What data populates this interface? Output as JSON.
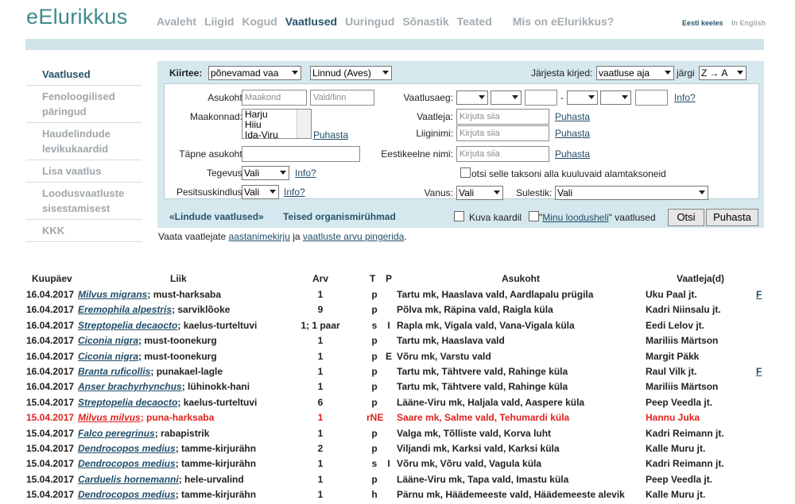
{
  "logo": "eElurikkus",
  "topnav": [
    "Avaleht",
    "Liigid",
    "Kogud",
    "Vaatlused",
    "Uuringud",
    "Sõnastik",
    "Teated"
  ],
  "topnav_active": "Vaatlused",
  "topnav_about": "Mis on eElurikkus?",
  "lang": {
    "et": "Eesti keeles",
    "en": "In English"
  },
  "sidebar": [
    {
      "label": "Vaatlused",
      "active": true
    },
    {
      "label": "Fenoloogilised päringud"
    },
    {
      "label": "Haudelindude levikukaardid"
    },
    {
      "label": "Lisa vaatlus"
    },
    {
      "label": "Loodusvaatluste sisestamisest"
    },
    {
      "label": "KKK"
    }
  ],
  "filter": {
    "kiirtee_label": "Kiirtee:",
    "kiirtee_value": "põnevamad vaa",
    "group_value": "Linnud (Aves)",
    "sort_label": "Järjesta kirjed:",
    "sort_value": "vaatluse aja",
    "sort_by_label": "järgi",
    "order_value": "Z → A",
    "asukoht_label": "Asukoht:",
    "maakond_placeholder": "Maakond",
    "vald_placeholder": "Vald/linn",
    "vaatlusaeg_label": "Vaatlusaeg:",
    "range_sep": "-",
    "info_label": "Info?",
    "maakonnad_label": "Maakonnad:",
    "maakonnad_options": [
      "Harju",
      "Hiiu",
      "Ida-Viru"
    ],
    "puhasta_label": "Puhasta",
    "vaatleja_label": "Vaatleja:",
    "kirjuta_placeholder": "Kirjuta siia",
    "liiginimi_label": "Liiginimi:",
    "tapne_label": "Täpne asukoht:",
    "eesti_label": "Eestikeelne nimi:",
    "tegevus_label": "Tegevus:",
    "vali_label": "Vali",
    "subtaxa_label": "otsi selle taksoni alla kuuluvaid alamtaksoneid",
    "pesitsus_label": "Pesitsuskindlus:",
    "vanus_label": "Vanus:",
    "sulestik_label": "Sulestik:",
    "lindude_link": "«Lindude vaatlused»",
    "teised_link": "Teised organismirühmad",
    "kaardil_label": "Kuva kaardil",
    "minu_pre": "\"",
    "minu_link": "Minu loodusheli",
    "minu_post": "\" vaatlused",
    "otsi_button": "Otsi",
    "puhasta_button": "Puhasta"
  },
  "note": {
    "pre": "Vaata vaatlejate ",
    "link1": "aastanimekirju",
    "mid": " ja ",
    "link2": "vaatluste arvu pingerida",
    "post": "."
  },
  "table": {
    "headers": {
      "date": "Kuupäev",
      "species": "Liik",
      "count": "Arv",
      "t": "T",
      "p": "P",
      "location": "Asukoht",
      "observer": "Vaatleja(d)"
    },
    "rows": [
      {
        "date": "16.04.2017",
        "latin": "Milvus migrans",
        "est": "; must-harksaba",
        "count": "1",
        "t": "p",
        "p": "",
        "location": "Tartu mk, Haaslava vald, Aardlapalu prügila",
        "observer": "Uku Paal jt.",
        "extra": "F"
      },
      {
        "date": "16.04.2017",
        "latin": "Eremophila alpestris",
        "est": "; sarviklõoke",
        "count": "9",
        "t": "p",
        "p": "",
        "location": "Põlva mk, Räpina vald, Raigla küla",
        "observer": "Kadri Niinsalu jt.",
        "extra": ""
      },
      {
        "date": "16.04.2017",
        "latin": "Streptopelia decaocto",
        "est": "; kaelus-turteltuvi",
        "count": "1; 1 paar",
        "t": "s",
        "p": "I",
        "location": "Rapla mk, Vigala vald, Vana-Vigala küla",
        "observer": "Eedi Lelov jt.",
        "extra": ""
      },
      {
        "date": "16.04.2017",
        "latin": "Ciconia nigra",
        "est": "; must-toonekurg",
        "count": "1",
        "t": "p",
        "p": "",
        "location": "Tartu mk, Haaslava vald",
        "observer": "Mariliis Märtson",
        "extra": ""
      },
      {
        "date": "16.04.2017",
        "latin": "Ciconia nigra",
        "est": "; must-toonekurg",
        "count": "1",
        "t": "p",
        "p": "E",
        "location": "Võru mk, Varstu vald",
        "observer": "Margit Päkk",
        "extra": ""
      },
      {
        "date": "16.04.2017",
        "latin": "Branta ruficollis",
        "est": "; punakael-lagle",
        "count": "1",
        "t": "p",
        "p": "",
        "location": "Tartu mk, Tähtvere vald, Rahinge küla",
        "observer": "Raul Vilk jt.",
        "extra": "F"
      },
      {
        "date": "16.04.2017",
        "latin": "Anser brachyrhynchus",
        "est": "; lühinokk-hani",
        "count": "1",
        "t": "p",
        "p": "",
        "location": "Tartu mk, Tähtvere vald, Rahinge küla",
        "observer": "Mariliis Märtson",
        "extra": ""
      },
      {
        "date": "15.04.2017",
        "latin": "Streptopelia decaocto",
        "est": "; kaelus-turteltuvi",
        "count": "6",
        "t": "p",
        "p": "",
        "location": "Lääne-Viru mk, Haljala vald, Aaspere küla",
        "observer": "Peep Veedla jt.",
        "extra": ""
      },
      {
        "date": "15.04.2017",
        "latin": "Milvus milvus",
        "est": "; puna-harksaba",
        "count": "1",
        "t": "rNE",
        "p": "",
        "location": "Saare mk, Salme vald, Tehumardi küla",
        "observer": "Hannu Juka",
        "extra": "",
        "highlight": true
      },
      {
        "date": "15.04.2017",
        "latin": "Falco peregrinus",
        "est": "; rabapistrik",
        "count": "1",
        "t": "p",
        "p": "",
        "location": "Valga mk, Tõlliste vald, Korva luht",
        "observer": "Kadri Reimann jt.",
        "extra": ""
      },
      {
        "date": "15.04.2017",
        "latin": "Dendrocopos medius",
        "est": "; tamme-kirjurähn",
        "count": "2",
        "t": "p",
        "p": "",
        "location": "Viljandi mk, Karksi vald, Karksi küla",
        "observer": "Kalle Muru jt.",
        "extra": ""
      },
      {
        "date": "15.04.2017",
        "latin": "Dendrocopos medius",
        "est": "; tamme-kirjurähn",
        "count": "1",
        "t": "s",
        "p": "I",
        "location": "Võru mk, Võru vald, Vagula küla",
        "observer": "Kadri Reimann jt.",
        "extra": ""
      },
      {
        "date": "15.04.2017",
        "latin": "Carduelis hornemanni",
        "est": "; hele-urvalind",
        "count": "1",
        "t": "p",
        "p": "",
        "location": "Lääne-Viru mk, Tapa vald, Imastu küla",
        "observer": "Peep Veedla jt.",
        "extra": ""
      },
      {
        "date": "15.04.2017",
        "latin": "Dendrocopos medius",
        "est": "; tamme-kirjurähn",
        "count": "1",
        "t": "h",
        "p": "",
        "location": "Pärnu mk, Häädemeeste vald, Häädemeeste alevik",
        "observer": "Kalle Muru jt.",
        "extra": ""
      }
    ]
  },
  "colors": {
    "accent": "#27546b",
    "highlight": "#e0231e",
    "panel": "#d5e8ee"
  }
}
